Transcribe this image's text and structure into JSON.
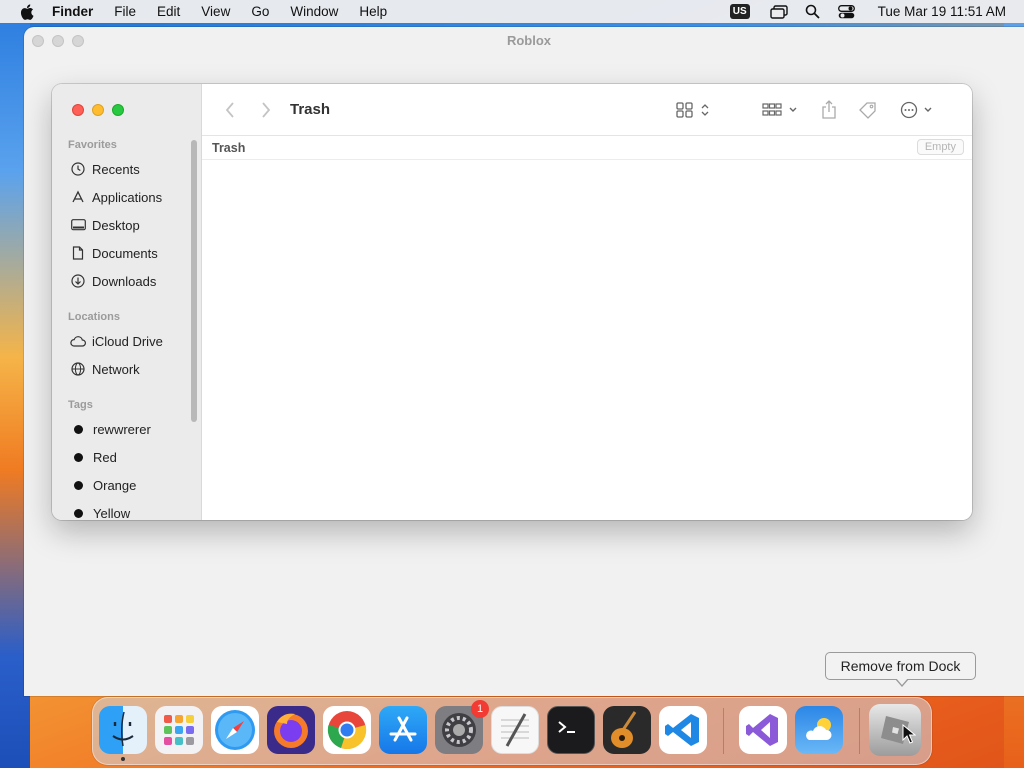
{
  "menubar": {
    "app_name": "Finder",
    "menus": [
      "File",
      "Edit",
      "View",
      "Go",
      "Window",
      "Help"
    ],
    "input_source": "US",
    "clock": "Tue Mar 19  11:51 AM"
  },
  "background_window": {
    "title": "Roblox"
  },
  "finder": {
    "title": "Trash",
    "path_label": "Trash",
    "empty_button": "Empty",
    "sidebar": {
      "favorites_header": "Favorites",
      "favorites": [
        {
          "label": "Recents",
          "icon": "clock-icon"
        },
        {
          "label": "Applications",
          "icon": "applications-icon"
        },
        {
          "label": "Desktop",
          "icon": "desktop-icon"
        },
        {
          "label": "Documents",
          "icon": "document-icon"
        },
        {
          "label": "Downloads",
          "icon": "download-icon"
        }
      ],
      "locations_header": "Locations",
      "locations": [
        {
          "label": "iCloud Drive",
          "icon": "cloud-icon"
        },
        {
          "label": "Network",
          "icon": "globe-icon"
        }
      ],
      "tags_header": "Tags",
      "tags": [
        {
          "label": "rewwrerer"
        },
        {
          "label": "Red"
        },
        {
          "label": "Orange"
        },
        {
          "label": "Yellow"
        }
      ]
    }
  },
  "dock": {
    "apps": [
      {
        "name": "finder-icon"
      },
      {
        "name": "launchpad-icon"
      },
      {
        "name": "safari-icon"
      },
      {
        "name": "firefox-icon"
      },
      {
        "name": "chrome-icon"
      },
      {
        "name": "app-store-icon"
      },
      {
        "name": "system-settings-icon",
        "badge": "1"
      },
      {
        "name": "textedit-icon"
      },
      {
        "name": "terminal-icon"
      },
      {
        "name": "garageband-icon"
      },
      {
        "name": "vscode-icon"
      },
      {
        "name": "visual-studio-icon"
      },
      {
        "name": "weather-icon"
      },
      {
        "name": "roblox-icon"
      }
    ],
    "tooltip": "Remove from Dock"
  }
}
